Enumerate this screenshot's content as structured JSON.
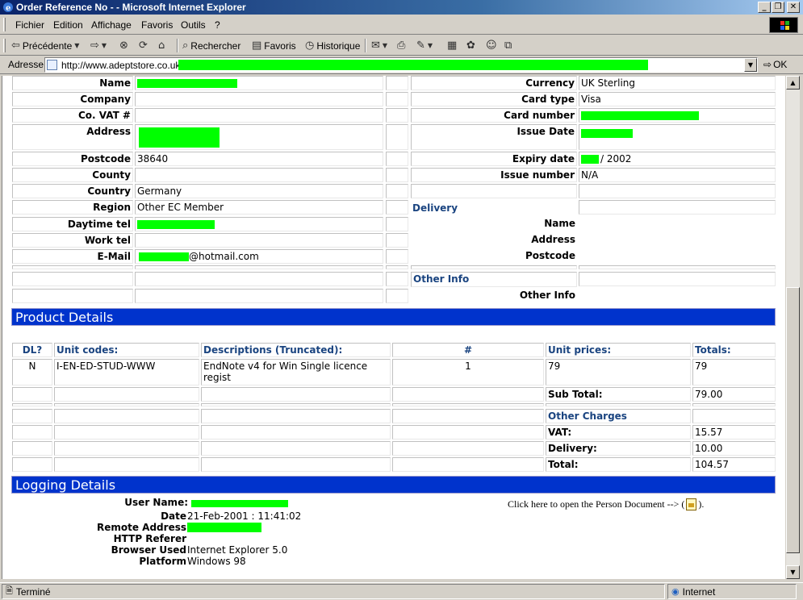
{
  "window": {
    "title": "Order Reference No - - Microsoft Internet Explorer",
    "buttons": {
      "minimize": "_",
      "maximize": "❐",
      "close": "✕"
    }
  },
  "menu": {
    "items": [
      "Fichier",
      "Edition",
      "Affichage",
      "Favoris",
      "Outils",
      "?"
    ]
  },
  "toolbar": {
    "back": "Précédente",
    "search": "Rechercher",
    "favorites": "Favoris",
    "history": "Historique"
  },
  "address": {
    "label": "Adresse",
    "url": "http://www.adeptstore.co.uk/",
    "go": "OK"
  },
  "customer": {
    "rows": [
      {
        "label": "Name",
        "value": ""
      },
      {
        "label": "Company",
        "value": ""
      },
      {
        "label": "Co. VAT #",
        "value": ""
      },
      {
        "label": "Address",
        "value": ""
      },
      {
        "label": "Postcode",
        "value": "38640"
      },
      {
        "label": "County",
        "value": ""
      },
      {
        "label": "Country",
        "value": "Germany"
      },
      {
        "label": "Region",
        "value": "Other EC Member"
      },
      {
        "label": "Daytime tel",
        "value": ""
      },
      {
        "label": "Work tel",
        "value": ""
      },
      {
        "label": "E-Mail",
        "value": "@hotmail.com"
      }
    ]
  },
  "payment": {
    "rows": [
      {
        "label": "Currency",
        "value": "UK Sterling"
      },
      {
        "label": "Card type",
        "value": "Visa"
      },
      {
        "label": "Card number",
        "value": ""
      },
      {
        "label": "Issue Date",
        "value": ""
      },
      {
        "label": "Expiry date",
        "value": "/ 2002"
      },
      {
        "label": "Issue number",
        "value": "N/A"
      }
    ]
  },
  "delivery": {
    "heading": "Delivery",
    "labels": [
      "Name",
      "Address",
      "Postcode"
    ]
  },
  "other_info": {
    "heading": "Other Info",
    "label": "Other Info"
  },
  "products": {
    "banner": "Product Details",
    "headers": [
      "DL?",
      "Unit codes:",
      "Descriptions (Truncated):",
      "#",
      "Unit prices:",
      "Totals:"
    ],
    "row": {
      "dl": "N",
      "code": "I-EN-ED-STUD-WWW",
      "desc_line1": "EndNote v4 for Win Single licence",
      "desc_line2": "regist",
      "qty": "1",
      "price": "79",
      "total": "79"
    },
    "subtotal_label": "Sub Total:",
    "subtotal": "79.00",
    "other_charges": "Other Charges",
    "vat_label": "VAT:",
    "vat": "15.57",
    "delivery_label": "Delivery:",
    "delivery": "10.00",
    "total_label": "Total:",
    "total": "104.57"
  },
  "logging": {
    "banner": "Logging Details",
    "user_name_label": "User Name:",
    "date_label": "Date",
    "date": "21-Feb-2001 : 11:41:02",
    "remote_label": "Remote Address",
    "referer_label": "HTTP Referer",
    "browser_label": "Browser Used",
    "browser": "Internet Explorer 5.0",
    "platform_label": "Platform",
    "platform": "Windows 98",
    "person_doc_text": "Click here to open the Person Document --> (",
    "person_doc_tail": ")."
  },
  "status": {
    "left": "Terminé",
    "zone": "Internet"
  },
  "colors": {
    "banner": "#0033cc",
    "redaction": "#00ff00",
    "heading_blue": "#1a4480"
  }
}
